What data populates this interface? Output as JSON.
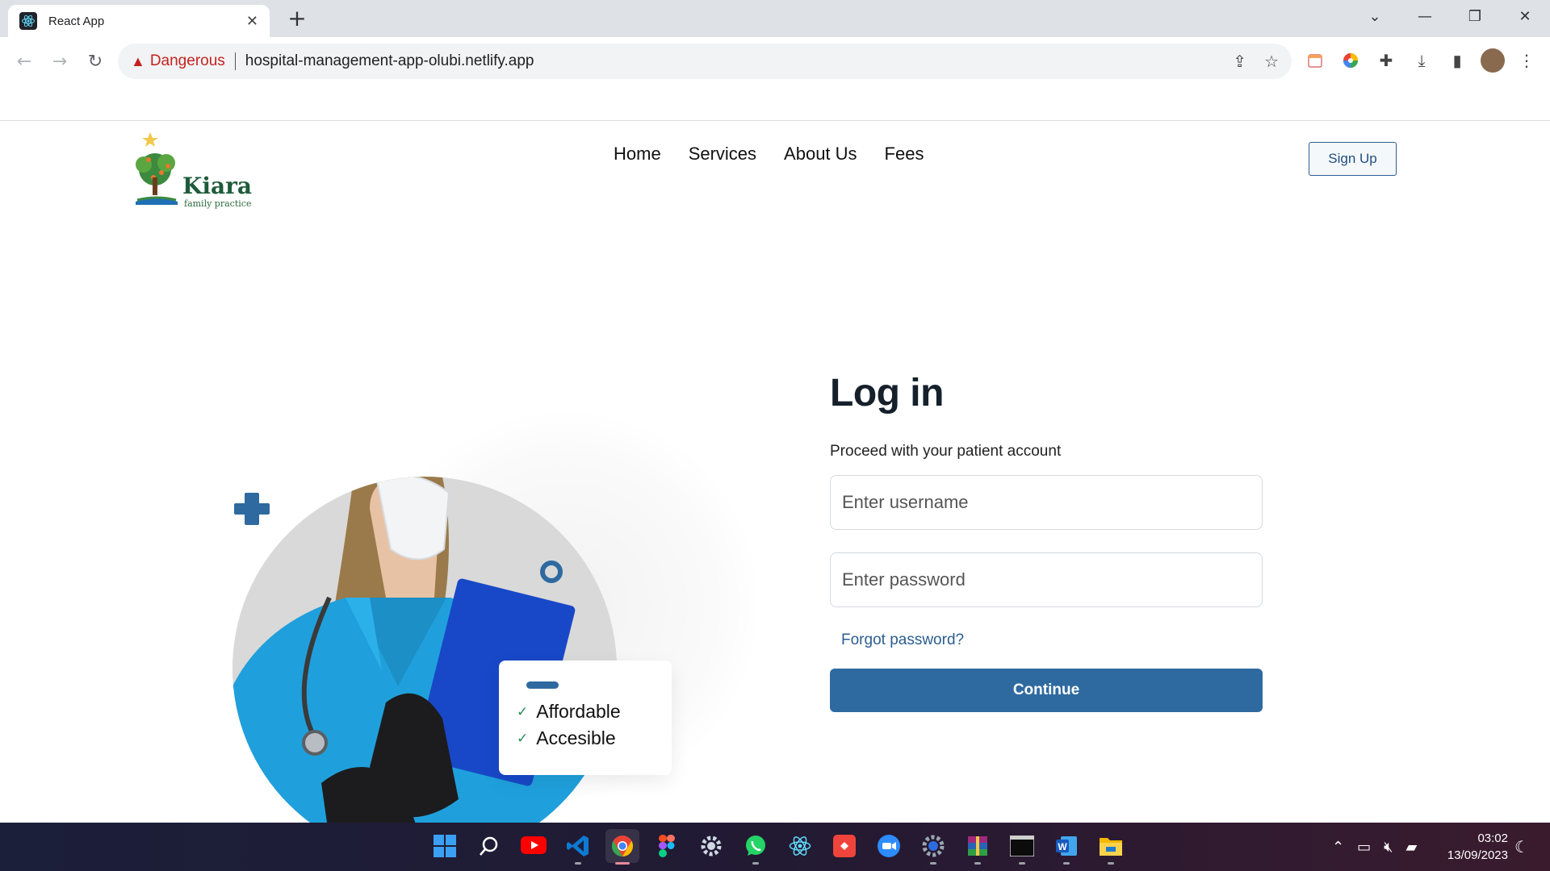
{
  "browser": {
    "tab_title": "React App",
    "tab_close": "✕",
    "new_tab": "+",
    "security_label": "Dangerous",
    "url": "hospital-management-app-olubi.netlify.app"
  },
  "site": {
    "logo_name": "Kiara",
    "logo_tagline": "family practice",
    "nav": [
      "Home",
      "Services",
      "About Us",
      "Fees"
    ],
    "signup_label": "Sign Up"
  },
  "hero": {
    "features": [
      "Affordable",
      "Accesible"
    ]
  },
  "login": {
    "title": "Log in",
    "subtitle": "Proceed with your patient account",
    "username_placeholder": "Enter username",
    "password_placeholder": "Enter password",
    "forgot_label": "Forgot password?",
    "continue_label": "Continue"
  },
  "taskbar": {
    "time": "03:02",
    "date": "13/09/2023",
    "apps": [
      "windows-start-icon",
      "search-icon",
      "youtube-icon",
      "vscode-icon",
      "chrome-icon",
      "figma-icon",
      "settings-icon",
      "whatsapp-icon",
      "react-icon",
      "anydesk-icon",
      "zoom-icon",
      "settings-gear-icon",
      "winrar-icon",
      "terminal-icon",
      "word-icon",
      "file-explorer-icon"
    ]
  },
  "colors": {
    "primary": "#2e6aa0",
    "danger": "#c5221f",
    "nurse_scrubs": "#1fa0dc"
  }
}
